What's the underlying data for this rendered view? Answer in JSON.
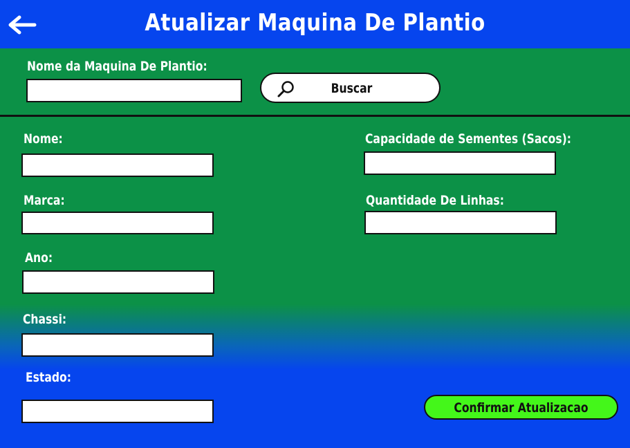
{
  "header": {
    "title": "Atualizar Maquina De Plantio",
    "back_icon": "arrow-left-icon"
  },
  "search": {
    "label": "Nome da Maquina De Plantio:",
    "value": "",
    "button_label": "Buscar",
    "button_icon": "magnifier-icon"
  },
  "form": {
    "nome": {
      "label": "Nome:",
      "value": ""
    },
    "marca": {
      "label": "Marca:",
      "value": ""
    },
    "ano": {
      "label": "Ano:",
      "value": ""
    },
    "chassi": {
      "label": "Chassi:",
      "value": ""
    },
    "estado": {
      "label": "Estado:",
      "value": ""
    },
    "capacidade": {
      "label": "Capacidade de Sementes (Sacos):",
      "value": ""
    },
    "linhas": {
      "label": "Quantidade De Linhas:",
      "value": ""
    }
  },
  "actions": {
    "confirm_label": "Confirmar Atualizacao"
  },
  "colors": {
    "header_blue": "#0645ee",
    "form_green": "#0c9147",
    "confirm_green": "#44f71a"
  }
}
